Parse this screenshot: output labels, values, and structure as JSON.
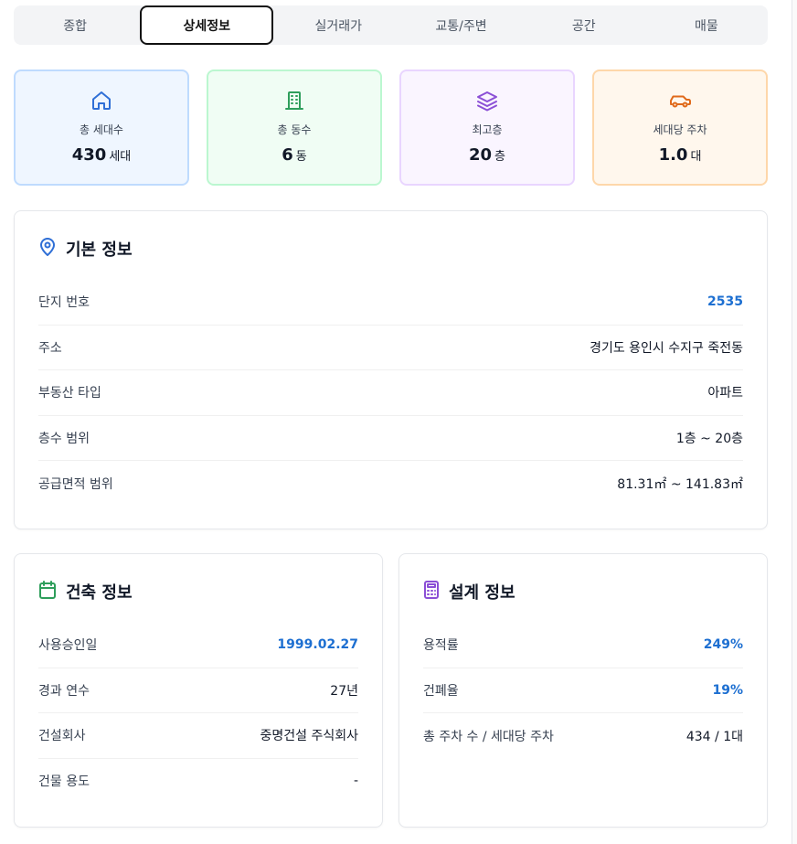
{
  "tabs": [
    {
      "label": "종합"
    },
    {
      "label": "상세정보"
    },
    {
      "label": "실거래가"
    },
    {
      "label": "교통/주변"
    },
    {
      "label": "공간"
    },
    {
      "label": "매물"
    }
  ],
  "active_tab": "상세정보",
  "stats": [
    {
      "icon": "house-icon",
      "label": "총 세대수",
      "value": "430",
      "unit": "세대",
      "color": "#2f6fd6"
    },
    {
      "icon": "building-icon",
      "label": "총 동수",
      "value": "6",
      "unit": "동",
      "color": "#2e9e5b"
    },
    {
      "icon": "layers-icon",
      "label": "최고층",
      "value": "20",
      "unit": "층",
      "color": "#8b4fd6"
    },
    {
      "icon": "car-icon",
      "label": "세대당 주차",
      "value": "1.0",
      "unit": "대",
      "color": "#e06a1b"
    }
  ],
  "basic_info": {
    "title": "기본 정보",
    "rows": [
      {
        "label": "단지 번호",
        "value": "2535"
      },
      {
        "label": "주소",
        "value": "경기도 용인시 수지구 죽전동"
      },
      {
        "label": "부동산 타입",
        "value": "아파트"
      },
      {
        "label": "층수 범위",
        "value": "1층 ~ 20층"
      },
      {
        "label": "공급면적 범위",
        "value": "81.31㎡ ~ 141.83㎡"
      }
    ]
  },
  "build_info": {
    "title": "건축 정보",
    "rows": [
      {
        "label": "사용승인일",
        "value": "1999.02.27"
      },
      {
        "label": "경과 연수",
        "value": "27년"
      },
      {
        "label": "건설회사",
        "value": "중명건설 주식회사"
      },
      {
        "label": "건물 용도",
        "value": "-"
      }
    ]
  },
  "design_info": {
    "title": "설계 정보",
    "rows": [
      {
        "label": "용적률",
        "value": "249%"
      },
      {
        "label": "건폐율",
        "value": "19%"
      },
      {
        "label": "총 주차 수 / 세대당 주차",
        "value": "434 / 1대"
      }
    ]
  },
  "colors": {
    "accent": "#1d6fd1",
    "location_icon": "#2f6fd6",
    "calendar_icon": "#2e9e5b",
    "calculator_icon": "#8b4fd6"
  }
}
